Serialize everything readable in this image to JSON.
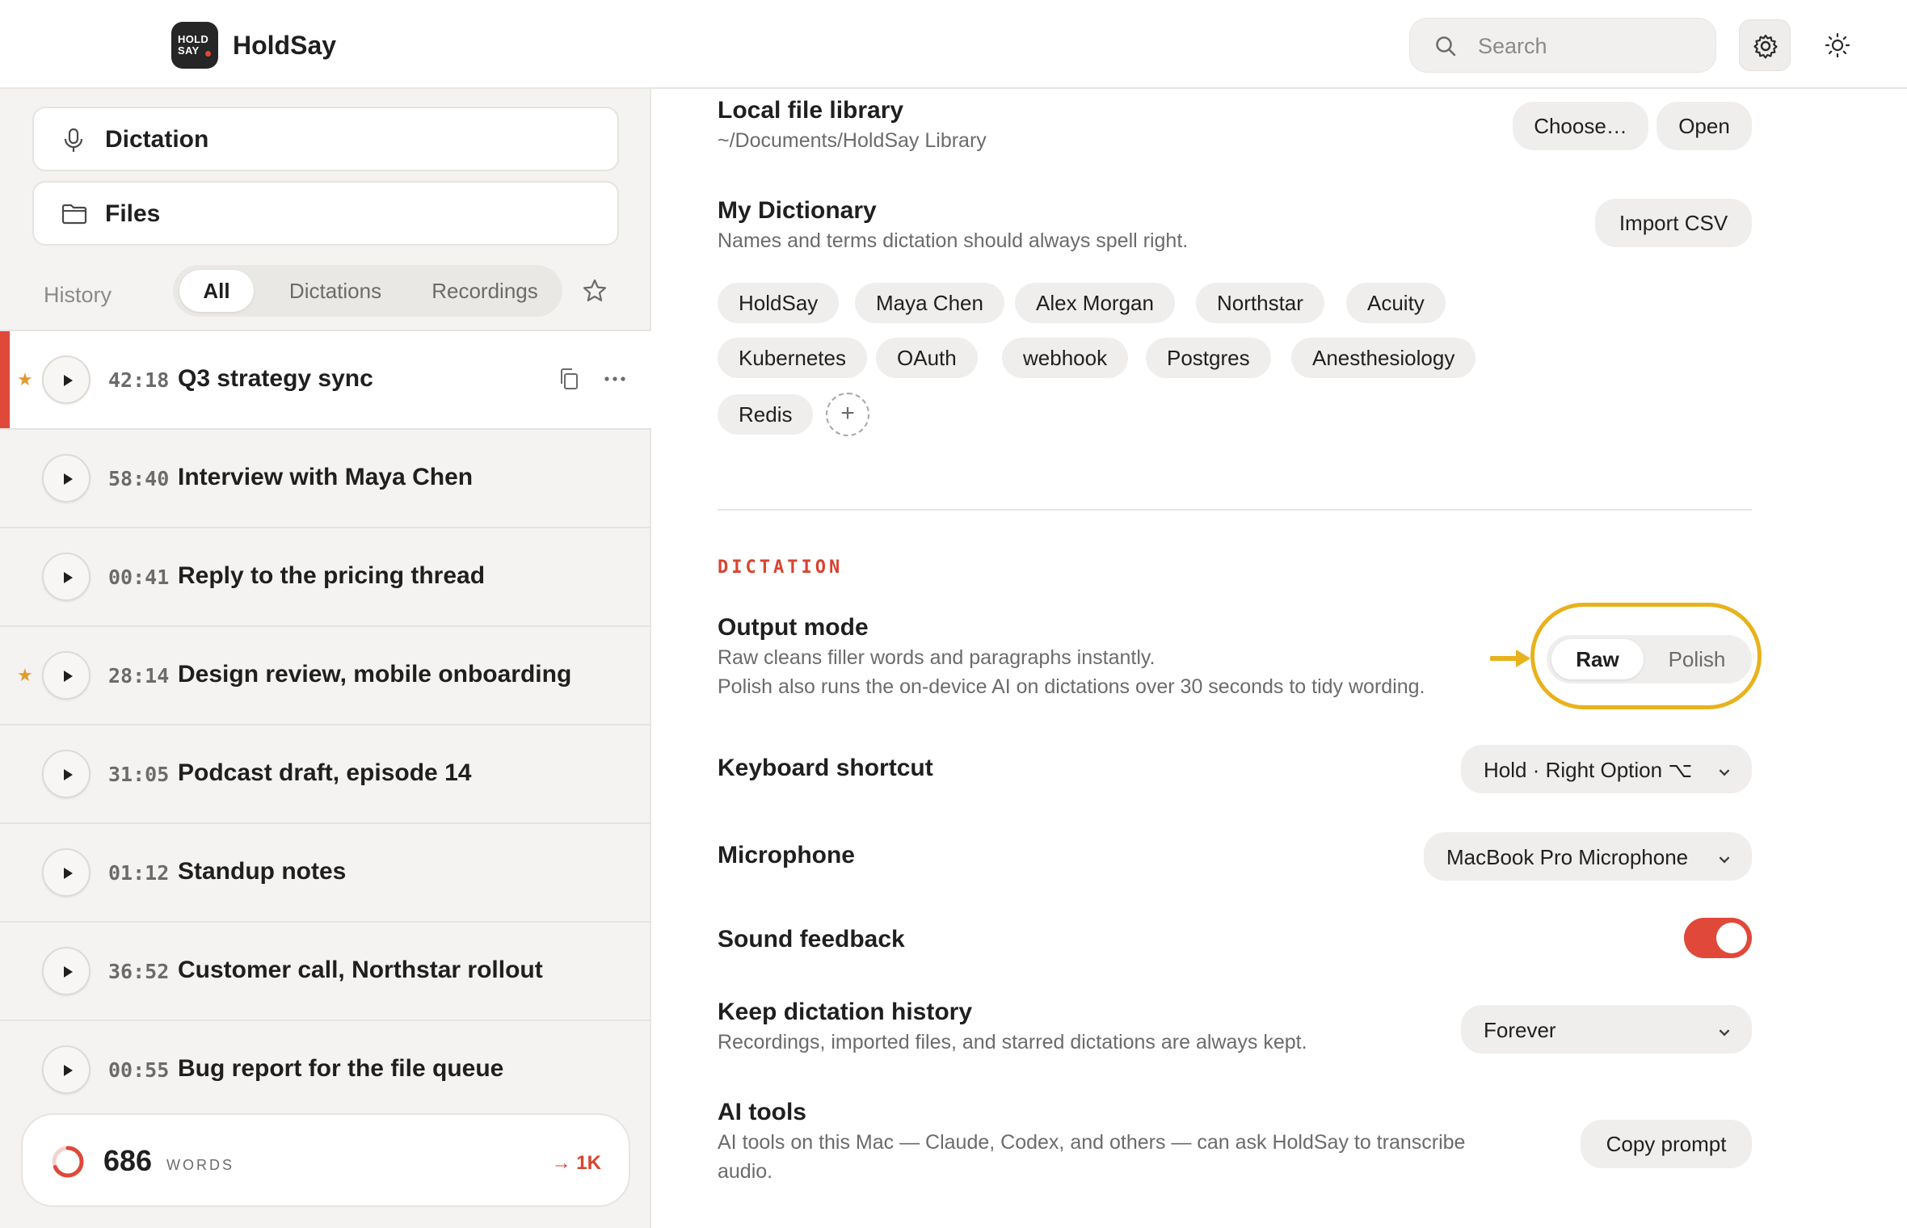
{
  "app": {
    "logo_line1": "HOLD",
    "logo_line2": "SAY",
    "name": "HoldSay"
  },
  "search": {
    "placeholder": "Search"
  },
  "colors": {
    "accent": "#e0483a",
    "highlight": "#e8b21c",
    "star": "#e29b2e"
  },
  "icons": {
    "search": "search-icon",
    "settings": "gear-icon",
    "theme": "sun-icon"
  },
  "sidebar": {
    "nav": [
      {
        "label": "Dictation",
        "icon": "microphone-icon"
      },
      {
        "label": "Files",
        "icon": "folder-icon"
      }
    ],
    "history_label": "History",
    "filters": [
      "All",
      "Dictations",
      "Recordings"
    ],
    "active_filter": "All",
    "items": [
      {
        "time": "42:18",
        "title": "Q3 strategy sync",
        "starred": true,
        "active": true
      },
      {
        "time": "58:40",
        "title": "Interview with Maya Chen",
        "starred": false
      },
      {
        "time": "00:41",
        "title": "Reply to the pricing thread",
        "starred": false
      },
      {
        "time": "28:14",
        "title": "Design review, mobile onboarding",
        "starred": true
      },
      {
        "time": "31:05",
        "title": "Podcast draft, episode 14",
        "starred": false
      },
      {
        "time": "01:12",
        "title": "Standup notes",
        "starred": false
      },
      {
        "time": "36:52",
        "title": "Customer call, Northstar rollout",
        "starred": false
      },
      {
        "time": "00:55",
        "title": "Bug report for the file queue",
        "starred": false
      }
    ],
    "words": {
      "count": "686",
      "unit": "WORDS",
      "goal": "→ 1K",
      "progress": 0.686
    }
  },
  "settings": {
    "library": {
      "title": "Local file library",
      "path": "~/Documents/HoldSay Library",
      "choose_label": "Choose…",
      "open_label": "Open"
    },
    "dictionary": {
      "title": "My Dictionary",
      "desc": "Names and terms dictation should always spell right.",
      "import_label": "Import CSV",
      "terms": [
        "HoldSay",
        "Maya Chen",
        "Alex Morgan",
        "Northstar",
        "Acuity",
        "Kubernetes",
        "OAuth",
        "webhook",
        "Postgres",
        "Anesthesiology",
        "Redis"
      ],
      "add_label": "+"
    },
    "section_label": "DICTATION",
    "output_mode": {
      "title": "Output mode",
      "desc_line1": "Raw cleans filler words and paragraphs instantly.",
      "desc_line2": "Polish also runs the on-device AI on dictations over 30 seconds to tidy wording.",
      "options": [
        "Raw",
        "Polish"
      ],
      "selected": "Raw"
    },
    "shortcut": {
      "title": "Keyboard shortcut",
      "value": "Hold · Right Option ⌥"
    },
    "microphone": {
      "title": "Microphone",
      "value": "MacBook Pro Microphone"
    },
    "sound": {
      "title": "Sound feedback",
      "enabled": true
    },
    "history": {
      "title": "Keep dictation history",
      "desc": "Recordings, imported files, and starred dictations are always kept.",
      "value": "Forever"
    },
    "ai_tools": {
      "title": "AI tools",
      "desc_line1": "AI tools on this Mac — Claude, Codex, and others — can ask HoldSay to transcribe",
      "desc_line2": "audio.",
      "button_label": "Copy prompt"
    }
  }
}
